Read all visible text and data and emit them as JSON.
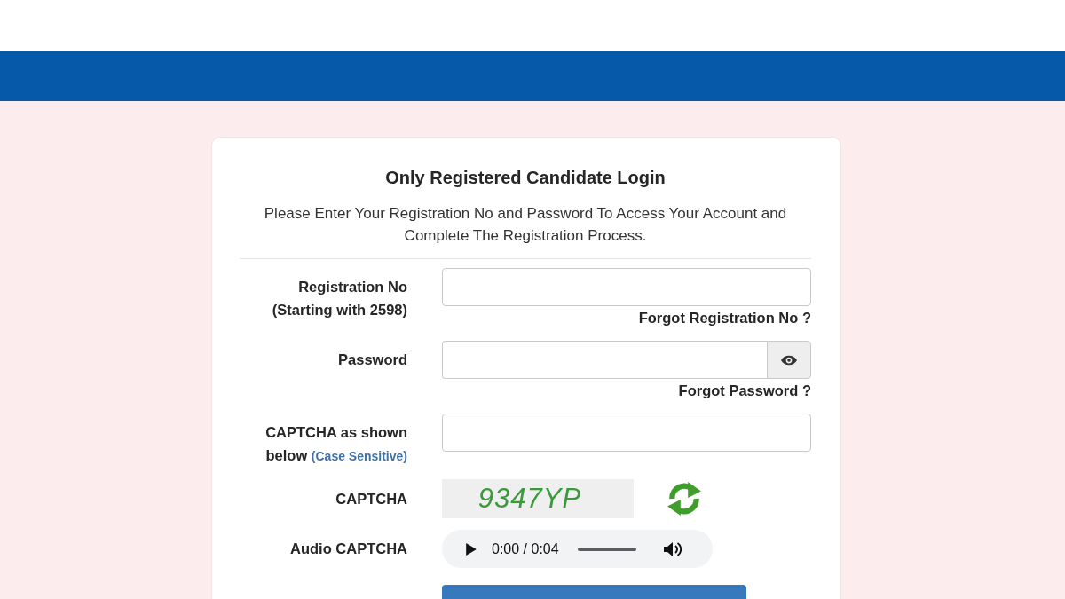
{
  "login_form": {
    "title": "Only Registered Candidate Login",
    "instructions": "Please Enter Your Registration No and Password To Access Your Account and Complete The Registration Process.",
    "rows": [
      {
        "kind": "input",
        "label": "Registration No (Starting with 2598)",
        "link": "Forgot Registration No ?"
      },
      {
        "kind": "password",
        "label": "Password",
        "link": "Forgot Password ?"
      },
      {
        "kind": "input",
        "label": "CAPTCHA as shown below",
        "note": "(Case Sensitive)"
      },
      {
        "kind": "captcha",
        "label": "CAPTCHA",
        "captcha_text": "9347YP"
      },
      {
        "kind": "audio",
        "label": "Audio CAPTCHA",
        "time": "0:00 / 0:04",
        "level": 0
      }
    ]
  }
}
